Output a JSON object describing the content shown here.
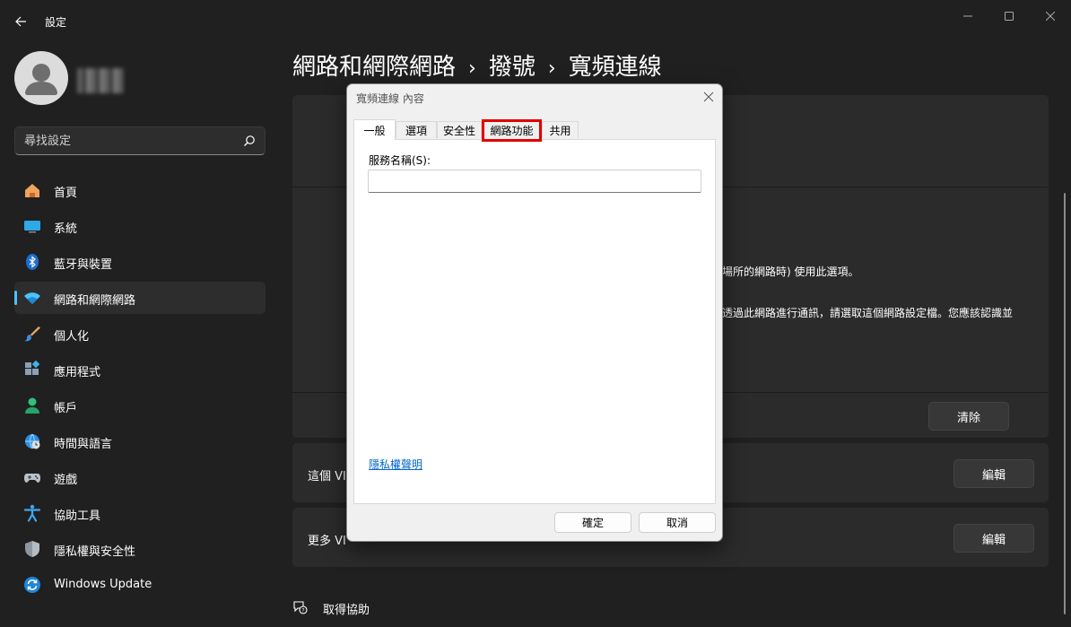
{
  "window": {
    "title": "設定"
  },
  "sidebar": {
    "search_placeholder": "尋找設定",
    "items": [
      {
        "label": "首頁",
        "icon": "home-icon",
        "active": false
      },
      {
        "label": "系統",
        "icon": "system-icon",
        "active": false
      },
      {
        "label": "藍牙與裝置",
        "icon": "bluetooth-icon",
        "active": false
      },
      {
        "label": "網路和網際網路",
        "icon": "wifi-icon",
        "active": true
      },
      {
        "label": "個人化",
        "icon": "brush-icon",
        "active": false
      },
      {
        "label": "應用程式",
        "icon": "apps-icon",
        "active": false
      },
      {
        "label": "帳戶",
        "icon": "account-icon",
        "active": false
      },
      {
        "label": "時間與語言",
        "icon": "globe-clock-icon",
        "active": false
      },
      {
        "label": "遊戲",
        "icon": "gamepad-icon",
        "active": false
      },
      {
        "label": "協助工具",
        "icon": "accessibility-icon",
        "active": false
      },
      {
        "label": "隱私權與安全性",
        "icon": "shield-icon",
        "active": false
      },
      {
        "label": "Windows Update",
        "icon": "update-icon",
        "active": false
      }
    ]
  },
  "main": {
    "breadcrumb": [
      "網路和網際網路",
      "撥號",
      "寬頻連線"
    ],
    "peek_text_1": "場所的網路時) 使用此選項。",
    "peek_text_2": "透過此網路進行通訊，請選取這個網路設定檔。您應該認識並",
    "clear_button": "清除",
    "row_vpn_label": "這個 VI",
    "row_vpn_edit": "編輯",
    "row_more_label": "更多 VI",
    "row_more_edit": "編輯",
    "help_label": "取得協助"
  },
  "dialog": {
    "title": "寬頻連線 內容",
    "tabs": [
      "一般",
      "選項",
      "安全性",
      "網路功能",
      "共用"
    ],
    "active_tab": "一般",
    "highlighted_tab": "網路功能",
    "service_name_label": "服務名稱(S):",
    "service_name_value": "",
    "privacy_link": "隱私權聲明",
    "ok_button": "確定",
    "cancel_button": "取消"
  },
  "colors": {
    "accent": "#4cc2ff",
    "highlight_box": "#e00000",
    "link": "#0066cc"
  }
}
